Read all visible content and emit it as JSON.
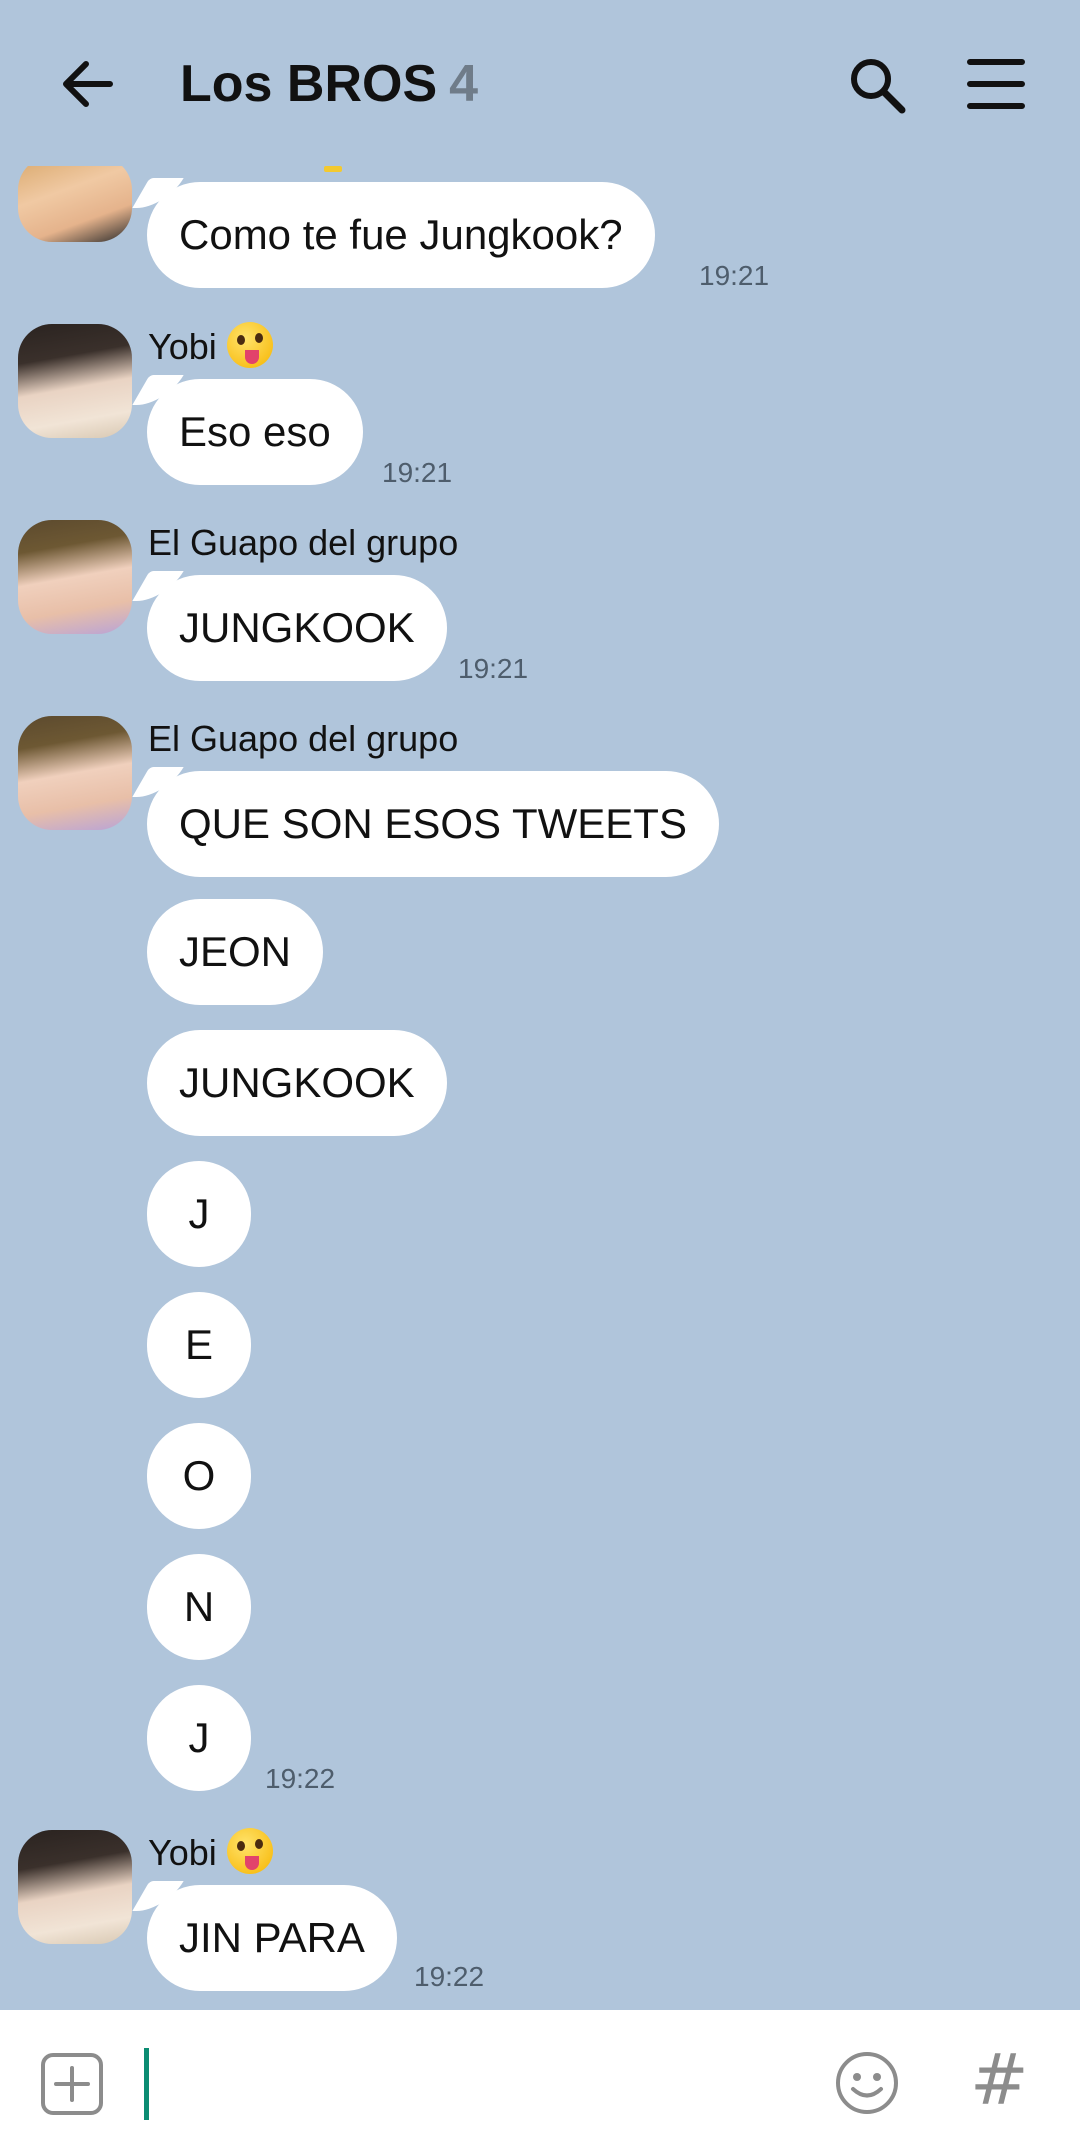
{
  "header": {
    "title": "Los BROS",
    "member_count": "4"
  },
  "colors": {
    "chat_background": "#b0c5db",
    "bubble": "#ffffff",
    "cursor": "#0b8c72"
  },
  "icons": {
    "back": "arrow-left-icon",
    "search": "search-icon",
    "menu": "hamburger-menu-icon",
    "add": "plus-square-icon",
    "emoji": "smiley-icon",
    "hashtag": "hashtag-icon"
  },
  "messages": [
    {
      "sender": "",
      "text": "Como te fue Jungkook?",
      "time": "19:21"
    },
    {
      "sender": "Yobi",
      "text": "Eso eso",
      "time": "19:21"
    },
    {
      "sender": "El Guapo del grupo",
      "text": "JUNGKOOK",
      "time": "19:21"
    },
    {
      "sender": "El Guapo del grupo",
      "text": "QUE SON ESOS TWEETS",
      "time": ""
    },
    {
      "sender": "",
      "text": "JEON",
      "time": ""
    },
    {
      "sender": "",
      "text": "JUNGKOOK",
      "time": ""
    },
    {
      "sender": "",
      "text": "J",
      "time": ""
    },
    {
      "sender": "",
      "text": "E",
      "time": ""
    },
    {
      "sender": "",
      "text": "O",
      "time": ""
    },
    {
      "sender": "",
      "text": "N",
      "time": ""
    },
    {
      "sender": "",
      "text": "J",
      "time": "19:22"
    },
    {
      "sender": "Yobi",
      "text": "JIN PARA",
      "time": "19:22"
    }
  ],
  "input": {
    "hashtag_label": "#"
  }
}
